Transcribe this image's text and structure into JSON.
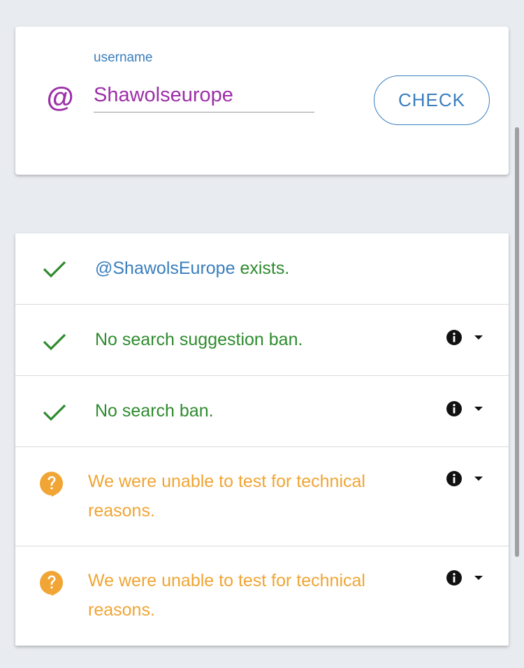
{
  "search": {
    "field_label": "username",
    "value": "Shawolseurope",
    "check_label": "CHECK"
  },
  "results": [
    {
      "status": "ok",
      "handle": "@ShawolsEurope",
      "text": " exists.",
      "has_details": false
    },
    {
      "status": "ok",
      "text": "No search suggestion ban.",
      "has_details": true
    },
    {
      "status": "ok",
      "text": "No search ban.",
      "has_details": true
    },
    {
      "status": "unknown",
      "text": "We were unable to test for technical reasons.",
      "has_details": true
    },
    {
      "status": "unknown",
      "text": "We were unable to test for technical reasons.",
      "has_details": true
    }
  ],
  "icons": {
    "at": "at-icon",
    "ok": "checkmark-icon",
    "unknown": "question-bubble-icon",
    "info": "info-icon",
    "expand": "caret-down-icon"
  },
  "colors": {
    "accent": "#3a7ebd",
    "username": "#9c2fa8",
    "ok": "#2e8b2e",
    "warn": "#f0a534"
  }
}
